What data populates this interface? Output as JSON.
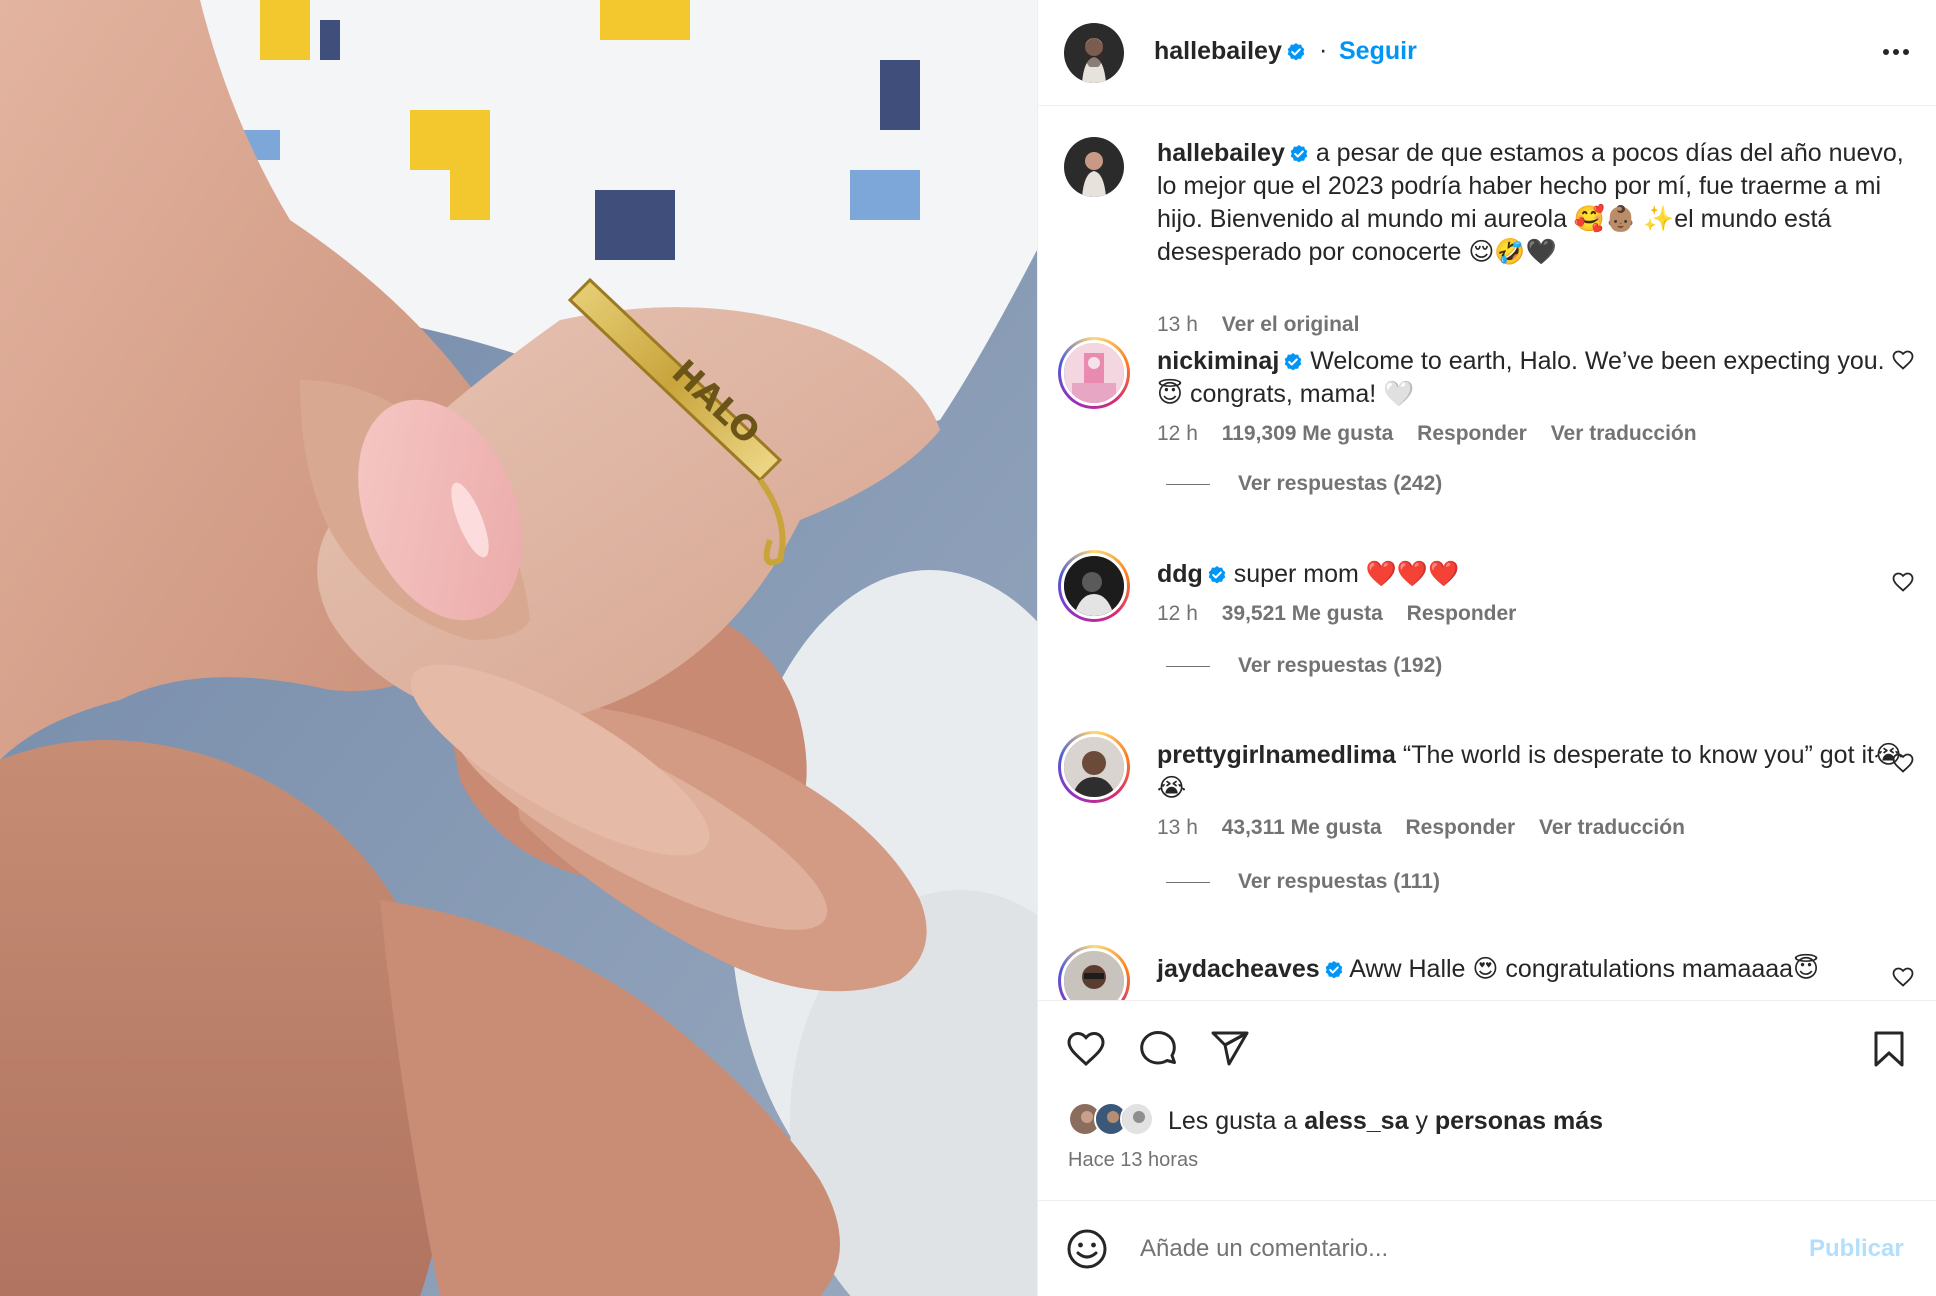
{
  "post": {
    "username": "hallebailey",
    "follow_label": "Seguir",
    "separator": "·",
    "caption": {
      "username": "hallebailey",
      "text": "a pesar de que estamos a pocos días del año nuevo, lo mejor que el 2023 podría haber hecho por mí, fue traerme a mi hijo. Bienvenido al mundo mi aureola 🥰👶🏽 ✨el mundo está desesperado por conocerte 😌🤣🖤",
      "time": "13 h",
      "see_original": "Ver el original"
    }
  },
  "photo": {
    "bracelet_text": "HALO"
  },
  "comments": [
    {
      "username": "nickiminaj",
      "text": "Welcome to earth, Halo. We’ve been expecting you. 😇 congrats, mama! 🤍",
      "time": "12 h",
      "likes": "119,309 Me gusta",
      "reply": "Responder",
      "translate": "Ver traducción",
      "replies": "Ver respuestas (242)"
    },
    {
      "username": "ddg",
      "text": "super mom ❤️❤️❤️",
      "time": "12 h",
      "likes": "39,521 Me gusta",
      "reply": "Responder",
      "replies": "Ver respuestas (192)"
    },
    {
      "username": "prettygirlnamedlima",
      "text": "“The world is desperate to know you” got it😭😭",
      "time": "13 h",
      "likes": "43,311 Me gusta",
      "reply": "Responder",
      "translate": "Ver traducción",
      "replies": "Ver respuestas (111)"
    },
    {
      "username": "jaydacheaves",
      "text": "Aww Halle 😍 congratulations mamaaaa😇"
    }
  ],
  "likes": {
    "prefix": "Les gusta a",
    "user": "aless_sa",
    "conj": "y",
    "rest": "personas más"
  },
  "time_ago": "Hace 13 horas",
  "comment_box": {
    "placeholder": "Añade un comentario...",
    "publish": "Publicar"
  },
  "icons": {
    "more": "more-options-icon",
    "like": "heart-icon",
    "comment": "comment-bubble-icon",
    "share": "paper-plane-icon",
    "save": "bookmark-icon",
    "emoji": "smiley-icon",
    "verified": "verified-badge-icon"
  },
  "colors": {
    "accent": "#0095f6",
    "verified": "#0095f6",
    "secondary_text": "#737373",
    "publish_disabled": "#b2dffc"
  }
}
